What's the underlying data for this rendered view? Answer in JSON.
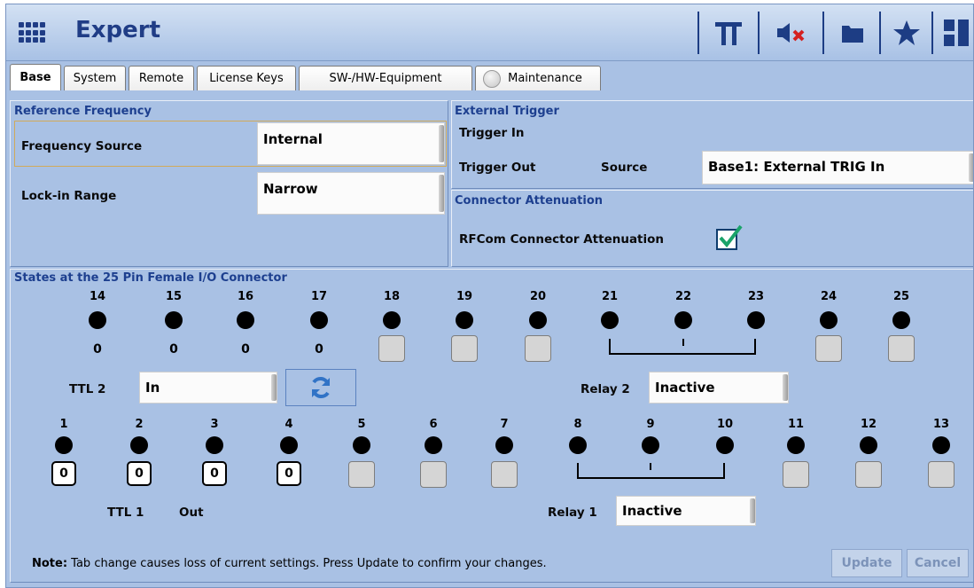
{
  "app": {
    "title": "Expert"
  },
  "toolbar": {
    "icons": [
      "pi-icon",
      "mute-icon",
      "folder-icon",
      "star-icon",
      "split-icon"
    ]
  },
  "tabs": [
    {
      "label": "Base",
      "active": true
    },
    {
      "label": "System"
    },
    {
      "label": "Remote"
    },
    {
      "label": "License Keys"
    },
    {
      "label": "SW-/HW-Equipment"
    },
    {
      "label": "Maintenance"
    }
  ],
  "ref_freq": {
    "title": "Reference Frequency",
    "source_label": "Frequency Source",
    "source_value": "Internal",
    "lock_label": "Lock-in Range",
    "lock_value": "Narrow"
  },
  "ext_trigger": {
    "title": "External Trigger",
    "trigger_in": "Trigger In",
    "trigger_out": "Trigger Out",
    "source_label": "Source",
    "source_value": "Base1: External TRIG In"
  },
  "connector_att": {
    "title": "Connector Attenuation",
    "label": "RFCom Connector Attenuation",
    "checked": true
  },
  "states": {
    "title": "States at the 25 Pin Female I/O Connector",
    "top_pins": [
      "14",
      "15",
      "16",
      "17",
      "18",
      "19",
      "20",
      "21",
      "22",
      "23",
      "24",
      "25"
    ],
    "top_values": [
      "0",
      "0",
      "0",
      "0"
    ],
    "ttl2_label": "TTL 2",
    "ttl2_value": "In",
    "relay2_label": "Relay 2",
    "relay2_value": "Inactive",
    "bottom_pins": [
      "1",
      "2",
      "3",
      "4",
      "5",
      "6",
      "7",
      "8",
      "9",
      "10",
      "11",
      "12",
      "13"
    ],
    "bottom_values": [
      "0",
      "0",
      "0",
      "0"
    ],
    "ttl1_label": "TTL 1",
    "ttl1_value": "Out",
    "relay1_label": "Relay 1",
    "relay1_value": "Inactive"
  },
  "footer": {
    "note_bold": "Note:",
    "note_text": " Tab change causes loss of current settings. Press Update to confirm your changes.",
    "update_label": "Update",
    "cancel_label": "Cancel"
  },
  "colors": {
    "accent": "#203d86",
    "panel": "#a9c1e4",
    "section_title": "#1d3f8f",
    "check": "#1aa36a"
  }
}
